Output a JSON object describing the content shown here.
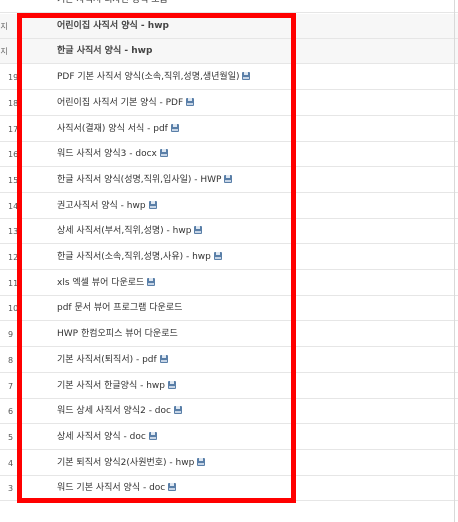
{
  "rows": [
    {
      "num": "",
      "title": "기본 사직서 디자인 양식 모음",
      "attach": false,
      "notice": false
    },
    {
      "num": "공지",
      "title": "어린이집 사직서 양식 - hwp",
      "attach": false,
      "notice": true
    },
    {
      "num": "공지",
      "title": "한글 사직서 양식 - hwp",
      "attach": false,
      "notice": true
    },
    {
      "num": "19",
      "title": "PDF 기본 사직서 양식(소속,직위,성명,생년월일)",
      "attach": true,
      "notice": false
    },
    {
      "num": "18",
      "title": "어린이집 사직서 기본 양식 - PDF",
      "attach": true,
      "notice": false
    },
    {
      "num": "17",
      "title": "사직서(결재) 양식 서식 - pdf",
      "attach": true,
      "notice": false
    },
    {
      "num": "16",
      "title": "워드 사직서 양식3 - docx",
      "attach": true,
      "notice": false
    },
    {
      "num": "15",
      "title": "한글 사직서 양식(성명,직위,입사일) - HWP",
      "attach": true,
      "notice": false
    },
    {
      "num": "14",
      "title": "권고사직서 양식 - hwp",
      "attach": true,
      "notice": false
    },
    {
      "num": "13",
      "title": "상세 사직서(부서,직위,성명) - hwp",
      "attach": true,
      "notice": false
    },
    {
      "num": "12",
      "title": "한글 사직서(소속,직위,성명,사유) - hwp",
      "attach": true,
      "notice": false
    },
    {
      "num": "11",
      "title": "xls 엑셀 뷰어 다운로드",
      "attach": true,
      "notice": false
    },
    {
      "num": "10",
      "title": "pdf 문서 뷰어 프로그램 다운로드",
      "attach": false,
      "notice": false
    },
    {
      "num": "9",
      "title": "HWP 한컴오피스 뷰어 다운로드",
      "attach": false,
      "notice": false
    },
    {
      "num": "8",
      "title": "기본 사직서(퇴직서) - pdf",
      "attach": true,
      "notice": false
    },
    {
      "num": "7",
      "title": "기본 사직서 한글양식 - hwp",
      "attach": true,
      "notice": false
    },
    {
      "num": "6",
      "title": "워드 상세 사직서 양식2 - doc",
      "attach": true,
      "notice": false
    },
    {
      "num": "5",
      "title": "상세 사직서 양식 - doc",
      "attach": true,
      "notice": false
    },
    {
      "num": "4",
      "title": "기본 퇴직서 양식2(사원번호) - hwp",
      "attach": true,
      "notice": false
    },
    {
      "num": "3",
      "title": "워드 기본 사직서 양식 - doc",
      "attach": true,
      "notice": false
    }
  ],
  "colors": {
    "highlight": "#ff0000",
    "notice_bg": "#f7f7f7",
    "attach_icon": "#5a7fa8"
  },
  "icons": {
    "attachment": "floppy-disk-icon"
  }
}
